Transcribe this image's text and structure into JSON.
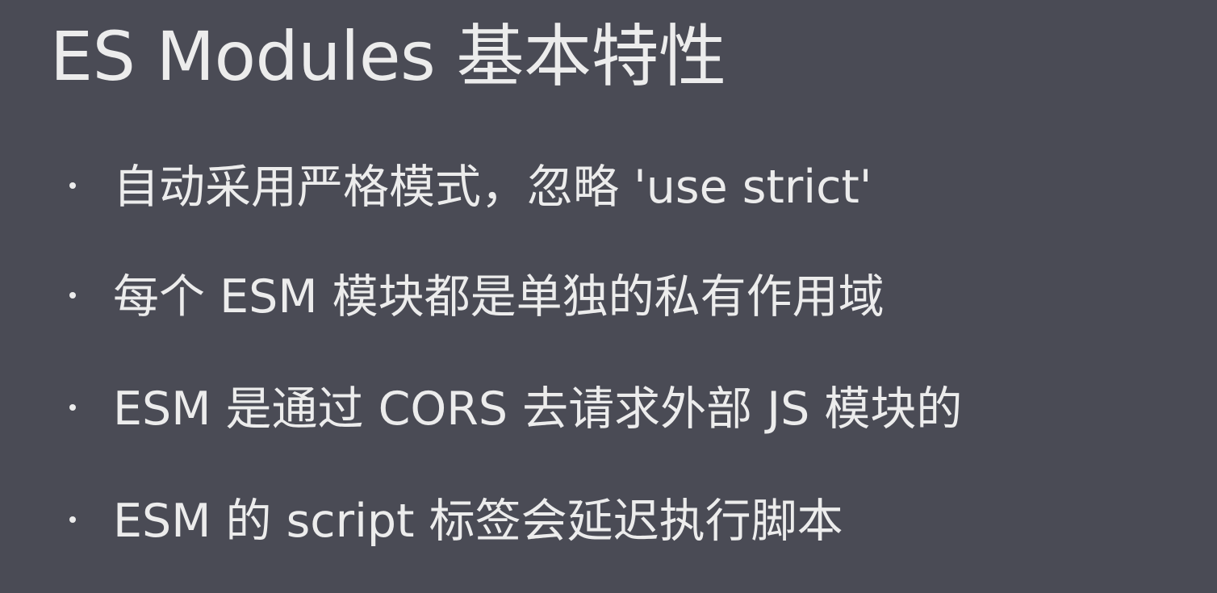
{
  "slide": {
    "title": "ES Modules 基本特性",
    "bullets": [
      {
        "text": "自动采用严格模式，忽略 'use strict'"
      },
      {
        "text": "每个 ESM 模块都是单独的私有作用域"
      },
      {
        "text": "ESM 是通过 CORS 去请求外部 JS 模块的"
      },
      {
        "text": "ESM 的 script 标签会延迟执行脚本"
      }
    ]
  },
  "colors": {
    "background": "#4a4b55",
    "text": "#ececec"
  }
}
